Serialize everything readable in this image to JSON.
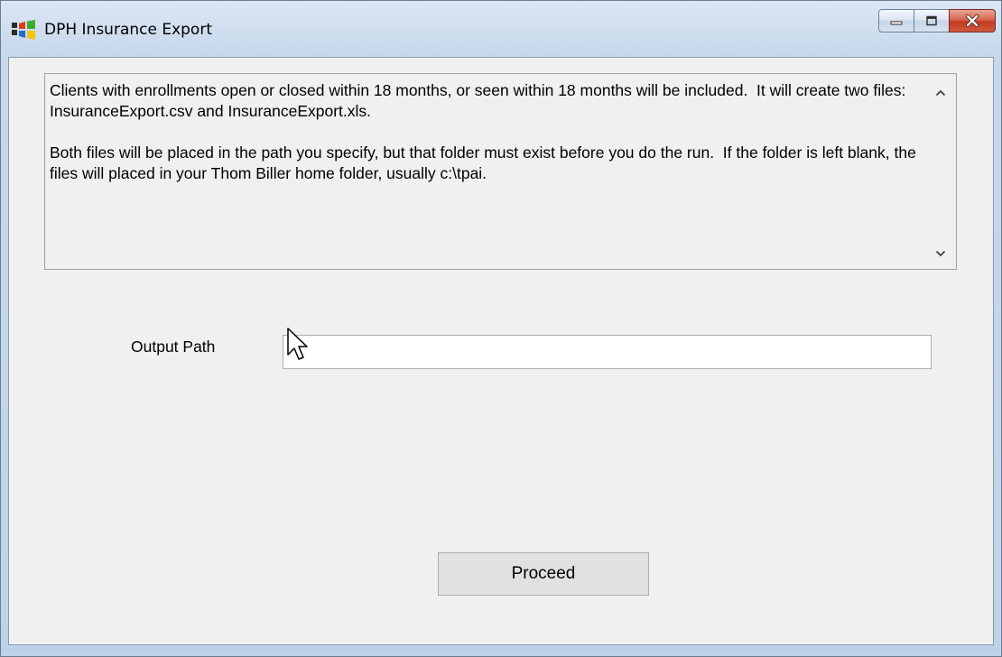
{
  "window": {
    "title": "DPH Insurance Export",
    "app_icon": "windows-flag-icon"
  },
  "caption_buttons": {
    "minimize_icon": "minimize-icon",
    "maximize_icon": "maximize-icon",
    "close_icon": "close-icon"
  },
  "info": {
    "text": "Clients with enrollments open or closed within 18 months, or seen within 18 months will be included.  It will create two files: InsuranceExport.csv and InsuranceExport.xls.\n\nBoth files will be placed in the path you specify, but that folder must exist before you do the run.  If the folder is left blank, the files will placed in your Thom Biller home folder, usually c:\\tpai."
  },
  "form": {
    "output_path_label": "Output Path",
    "output_path_value": ""
  },
  "actions": {
    "proceed_label": "Proceed"
  },
  "colors": {
    "close_button": "#c23a22",
    "client_background": "#f0f0f0",
    "frame": "#bed3ea"
  }
}
